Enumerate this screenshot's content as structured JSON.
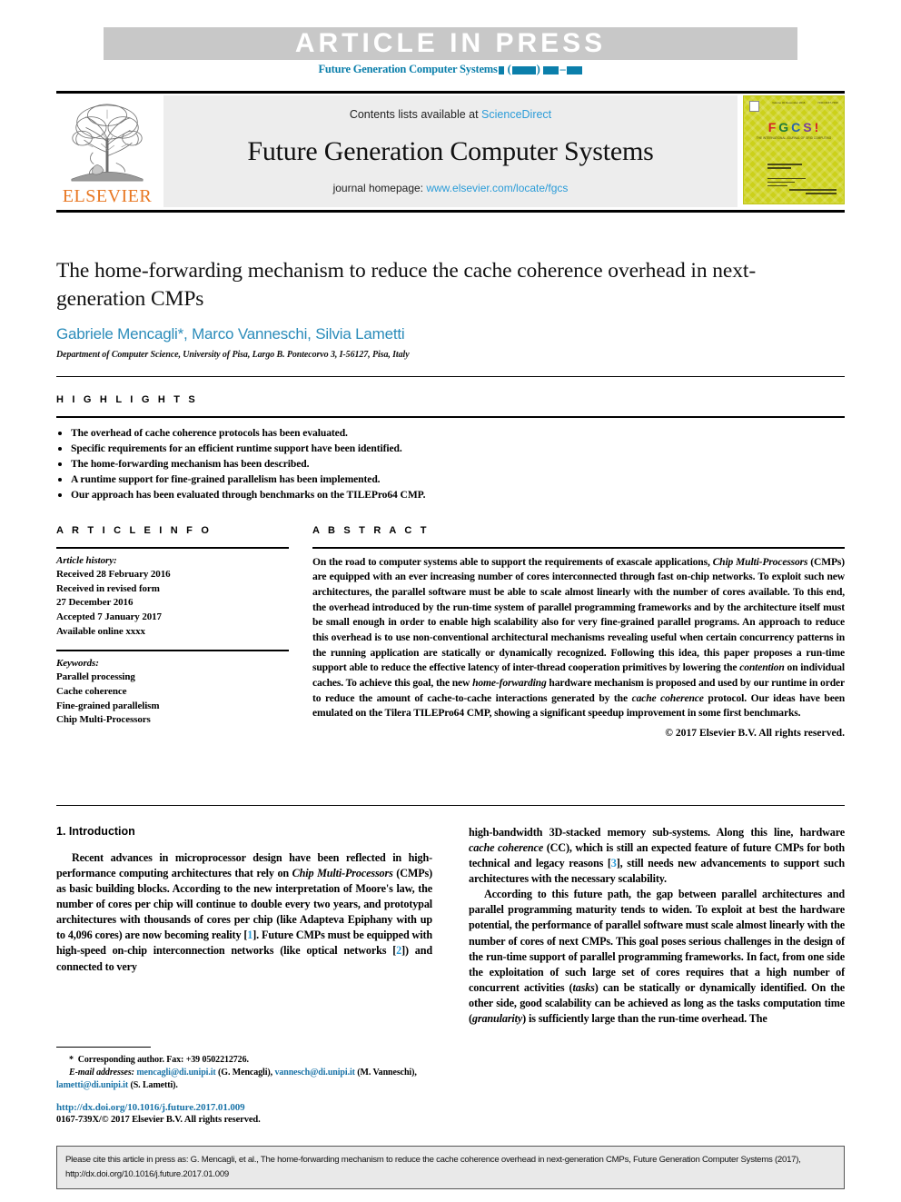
{
  "banner": {
    "text": "ARTICLE IN PRESS",
    "journal_ref_prefix": "Future Generation Computer Systems",
    "accent_color": "#0b7fab",
    "band_color": "#c8c8c8"
  },
  "masthead": {
    "contents_prefix": "Contents lists available at ",
    "sciencedirect": "ScienceDirect",
    "journal_title": "Future Generation Computer Systems",
    "homepage_prefix": "journal homepage: ",
    "homepage_url": "www.elsevier.com/locate/fgcs",
    "publisher": "ELSEVIER",
    "publisher_color": "#e87722",
    "link_color": "#2b9cd8",
    "cover": {
      "letters": [
        "F",
        "G",
        "C",
        "S",
        "!"
      ],
      "subtitle": "THE INTERNATIONAL JOURNAL OF GRID COMPUTING",
      "volume_text": "Volume 00  December 2016",
      "issn_text": "ISSN 0167-739X",
      "background_color": "#ccd11a"
    }
  },
  "article": {
    "title": "The home-forwarding mechanism to reduce the cache coherence overhead in next-generation CMPs",
    "authors": "Gabriele Mencagli*, Marco Vanneschi, Silvia Lametti",
    "authors_color": "#2b8cba",
    "affiliation": "Department of Computer Science, University of Pisa, Largo B. Pontecorvo 3, I-56127, Pisa, Italy"
  },
  "highlights": {
    "label": "H I G H L I G H T S",
    "items": [
      "The overhead of cache coherence protocols has been evaluated.",
      "Specific requirements for an efficient runtime support have been identified.",
      "The home-forwarding mechanism has been described.",
      "A runtime support for fine-grained parallelism has been implemented.",
      "Our approach has been evaluated through benchmarks on the TILEPro64 CMP."
    ]
  },
  "article_info": {
    "label": "A R T I C L E    I N F O",
    "history_label": "Article history:",
    "history": [
      "Received 28 February 2016",
      "Received in revised form",
      "27 December 2016",
      "Accepted 7 January 2017",
      "Available online xxxx"
    ],
    "keywords_label": "Keywords:",
    "keywords": [
      "Parallel processing",
      "Cache coherence",
      "Fine-grained parallelism",
      "Chip Multi-Processors"
    ]
  },
  "abstract": {
    "label": "A B S T R A C T",
    "p1_a": "On the road to computer systems able to support the requirements of exascale applications, ",
    "p1_i1": "Chip Multi-Processors",
    "p1_b": " (CMPs) are equipped with an ever increasing number of cores interconnected through fast on-chip networks. To exploit such new architectures, the parallel software must be able to scale almost linearly with the number of cores available. To this end, the overhead introduced by the run-time system of parallel programming frameworks and by the architecture itself must be small enough in order to enable high scalability also for very fine-grained parallel programs. An approach to reduce this overhead is to use non-conventional architectural mechanisms revealing useful when certain concurrency patterns in the running application are statically or dynamically recognized. Following this idea, this paper proposes a run-time support able to reduce the effective latency of inter-thread cooperation primitives by lowering the ",
    "p1_i2": "contention",
    "p1_c": " on individual caches. To achieve this goal, the new ",
    "p1_i3": "home-forwarding",
    "p1_d": " hardware mechanism is proposed and used by our runtime in order to reduce the amount of cache-to-cache interactions generated by the ",
    "p1_i4": "cache coherence",
    "p1_e": " protocol. Our ideas have been emulated on the Tilera TILEPro64 CMP, showing a significant speedup improvement in some first benchmarks.",
    "copyright": "© 2017 Elsevier B.V. All rights reserved."
  },
  "introduction": {
    "heading": "1. Introduction",
    "left_p1_a": "Recent advances in microprocessor design have been reflected in high-performance computing architectures that rely on ",
    "left_p1_i1": "Chip Multi-Processors",
    "left_p1_b": " (CMPs) as basic building blocks. According to the new interpretation of Moore's law, the number of cores per chip will continue to double every two years, and prototypal architectures with thousands of cores per chip (like Adapteva Epiphany with up to 4,096 cores) are now becoming reality [",
    "left_cit1": "1",
    "left_p1_c": "]. Future CMPs must be equipped with high-speed on-chip interconnection networks (like optical networks [",
    "left_cit2": "2",
    "left_p1_d": "]) and connected to very",
    "right_p1_a": "high-bandwidth 3D-stacked memory sub-systems. Along this line, hardware ",
    "right_p1_i1": "cache coherence",
    "right_p1_b": " (CC), which is still an expected feature of future CMPs for both technical and legacy reasons [",
    "right_cit3": "3",
    "right_p1_c": "], still needs new advancements to support such architectures with the necessary scalability.",
    "right_p2_a": "According to this future path, the gap between parallel architectures and parallel programming maturity tends to widen. To exploit at best the hardware potential, the performance of parallel software must scale almost linearly with the number of cores of next CMPs. This goal poses serious challenges in the design of the run-time support of parallel programming frameworks. In fact, from one side the exploitation of such large set of cores requires that a high number of concurrent activities (",
    "right_p2_i1": "tasks",
    "right_p2_b": ") can be statically or dynamically identified. On the other side, good scalability can be achieved as long as the tasks computation time (",
    "right_p2_i2": "granularity",
    "right_p2_c": ") is sufficiently large than the run-time overhead. The"
  },
  "footnotes": {
    "corresponding": "Corresponding author. Fax: +39 0502212726.",
    "email_label": "E-mail addresses:",
    "email1": "mencagli@di.unipi.it",
    "email1_who": " (G. Mencagli), ",
    "email2": "vannesch@di.unipi.it",
    "email2_who": " (M. Vanneschi), ",
    "email3": "lametti@di.unipi.it",
    "email3_who": " (S. Lametti).",
    "doi_url": "http://dx.doi.org/10.1016/j.future.2017.01.009",
    "issn_line": "0167-739X/© 2017 Elsevier B.V. All rights reserved.",
    "link_color": "#1b74a8"
  },
  "cite_box": {
    "text": "Please cite this article in press as: G. Mencagli, et al., The home-forwarding mechanism to reduce the cache coherence overhead in next-generation CMPs, Future Generation Computer Systems (2017), http://dx.doi.org/10.1016/j.future.2017.01.009"
  }
}
